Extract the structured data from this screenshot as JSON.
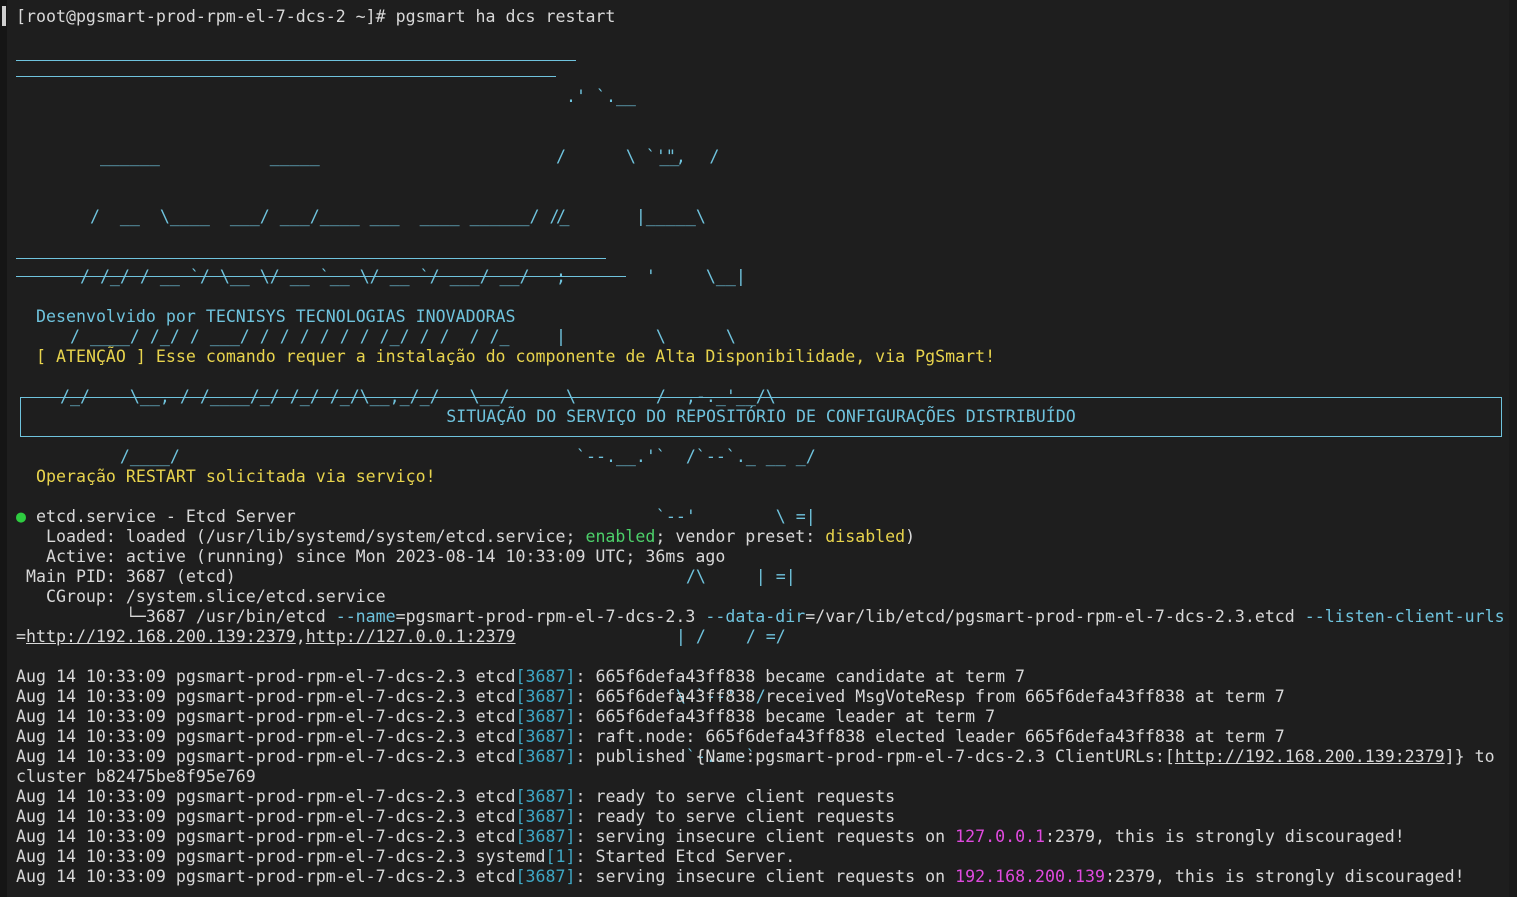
{
  "prompt": {
    "text": "[root@pgsmart-prod-rpm-el-7-dcs-2 ~]# pgsmart ha dcs restart"
  },
  "logo": {
    "lines": [
      "                                                                    _",
      "      ______           _____                                  __   /",
      "     /  __  \\____  ___/ ___/____ ___  ____ ______/ /_",
      "    / /_/ / __ `/ \\__ \\/ __ `__ \\/ __ `/ ___/ __/",
      "   / ____/ /_/ / ___/ / / / / / / /_/ / /  / /_",
      "  /_/    \\__, / /____/_/ /_/ /_/\\__,_/_/   \\__/",
      "        /____/"
    ],
    "elephant": [
      " .' `.__",
      "/      \\ `'\",",
      "/       |_____\\",
      ";        '     \\__|",
      "|         \\      \\",
      " \\        /  ,-._'__/\\",
      "  `--.__.'`  /`--`._ __ _/",
      "          `--'        \\ =|",
      "             /\\     | =|",
      "            | /    / =/",
      "            \\ `--'  /",
      "             `-...-`"
    ]
  },
  "credits": {
    "developed_by": "Desenvolvido por TECNISYS TECNOLOGIAS INOVADORAS",
    "warning": "[ ATENÇÃO ] Esse comando requer a instalação do componente de Alta Disponibilidade, via PgSmart!"
  },
  "banner": {
    "title": "SITUAÇÃO DO SERVIÇO DO REPOSITÓRIO DE CONFIGURAÇÕES DISTRIBUÍDO"
  },
  "operation": {
    "message": "Operação RESTART solicitada via serviço!"
  },
  "service": {
    "bullet": "●",
    "title": " etcd.service - Etcd Server",
    "loaded_prefix": "   Loaded: loaded (/usr/lib/systemd/system/etcd.service; ",
    "enabled": "enabled",
    "loaded_mid": "; vendor preset: ",
    "disabled": "disabled",
    "loaded_suffix": ")",
    "active": "   Active: active (running) since Mon 2023-08-14 10:33:09 UTC; 36ms ago",
    "main_pid": " Main PID: 3687 (etcd)",
    "cgroup": "   CGroup: /system.slice/etcd.service",
    "cmd_prefix": "           └─3687 /usr/bin/etcd ",
    "opt_name": "--name",
    "cmd_name_val": "=pgsmart-prod-rpm-el-7-dcs-2.3 ",
    "opt_datadir": "--data-dir",
    "cmd_datadir_val": "=/var/lib/etcd/pgsmart-prod-rpm-el-7-dcs-2.3.etcd ",
    "opt_listen": "--listen-client-urls",
    "cmd_eq": "=",
    "url1": "http://192.168.200.139:2379",
    "comma": ",",
    "url2": "http://127.0.0.1:2379"
  },
  "logs": {
    "prefix": "Aug 14 10:33:09 pgsmart-prod-rpm-el-7-dcs-2.3 ",
    "etcd": "etcd",
    "systemd": "systemd",
    "pid_etcd": "[3687]",
    "pid_systemd": "[1]",
    "entries": [
      ": 665f6defa43ff838 became candidate at term 7",
      ": 665f6defa43ff838 received MsgVoteResp from 665f6defa43ff838 at term 7",
      ": 665f6defa43ff838 became leader at term 7",
      ": raft.node: 665f6defa43ff838 elected leader 665f6defa43ff838 at term 7"
    ],
    "published_pre": ": published {Name:pgsmart-prod-rpm-el-7-dcs-2.3 ClientURLs:[",
    "published_url": "http://192.168.200.139:2379",
    "published_post": "]} to",
    "published_cont": "cluster b82475be8f95e769",
    "ready": ": ready to serve client requests",
    "insecure_pre": ": serving insecure client requests on ",
    "ip_local": "127.0.0.1",
    "ip_remote": "192.168.200.139",
    "insecure_post": ":2379, this is strongly discouraged!",
    "started": ": Started Etcd Server."
  },
  "colors": {
    "background": "#1e1e1e",
    "text": "#d8d8d8",
    "cyan": "#6fc3dd",
    "yellow": "#e8d44d",
    "green": "#4cd06a",
    "magenta": "#e04adf"
  }
}
